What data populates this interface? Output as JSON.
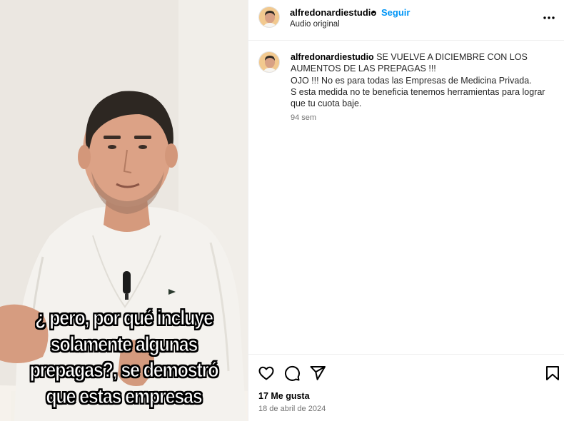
{
  "post": {
    "username": "alfredonardiestudio",
    "separator": "•",
    "follow_label": "Seguir",
    "audio_label": "Audio original"
  },
  "video": {
    "caption_lines": [
      "¿ pero, por qué incluye",
      "solamente algunas",
      "prepagas?, se demostró",
      "que estas empresas"
    ]
  },
  "comment": {
    "username": "alfredonardiestudio",
    "lines": [
      "SE VUELVE A DICIEMBRE CON LOS",
      "AUMENTOS DE LAS PREPAGAS !!!",
      "OJO !!! No es para todas las Empresas de Medicina Privada.",
      "S esta medida no te beneficia tenemos herramientas para lograr",
      "que tu cuota baje."
    ],
    "time": "94 sem"
  },
  "actions": {
    "icons": [
      "heart-icon",
      "comment-icon",
      "share-icon",
      "bookmark-icon"
    ]
  },
  "stats": {
    "likes": "17 Me gusta",
    "date": "18 de abril de 2024"
  },
  "colors": {
    "link_blue": "#0095f6",
    "muted_text": "#737373",
    "divider": "#efefef"
  }
}
